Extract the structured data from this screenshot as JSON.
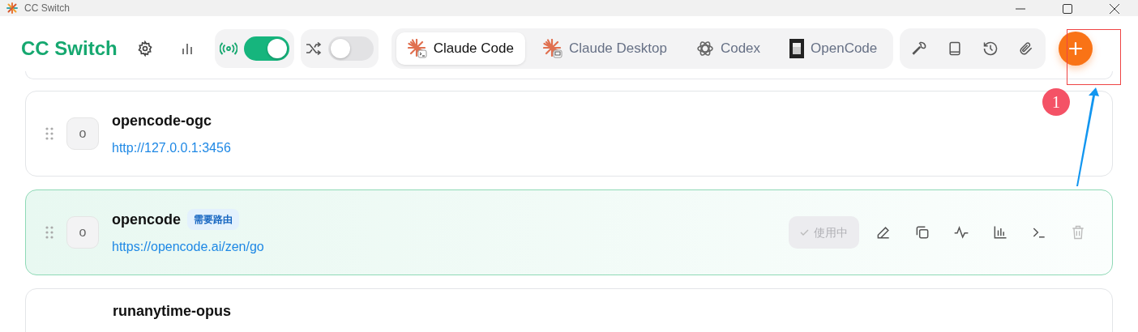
{
  "window": {
    "title": "CC Switch"
  },
  "header": {
    "app_title": "CC Switch",
    "proxy_toggle": {
      "on": true
    },
    "failover_toggle": {
      "on": false
    }
  },
  "tabs": [
    {
      "label": "Claude Code",
      "selected": true,
      "kind": "claude-code"
    },
    {
      "label": "Claude Desktop",
      "selected": false,
      "kind": "claude-desktop"
    },
    {
      "label": "Codex",
      "selected": false,
      "kind": "codex"
    },
    {
      "label": "OpenCode",
      "selected": false,
      "kind": "opencode"
    }
  ],
  "providers": [
    {
      "name": "opencode-ogc",
      "avatar": "o",
      "url": "http://127.0.0.1:3456",
      "selected": false
    },
    {
      "name": "opencode",
      "avatar": "o",
      "badge": "需要路由",
      "url": "https://opencode.ai/zen/go",
      "selected": true,
      "status_button": "使用中"
    },
    {
      "name": "runanytime-opus",
      "selected": false
    }
  ],
  "annotations": [
    {
      "kind": "step",
      "label": "1"
    }
  ]
}
